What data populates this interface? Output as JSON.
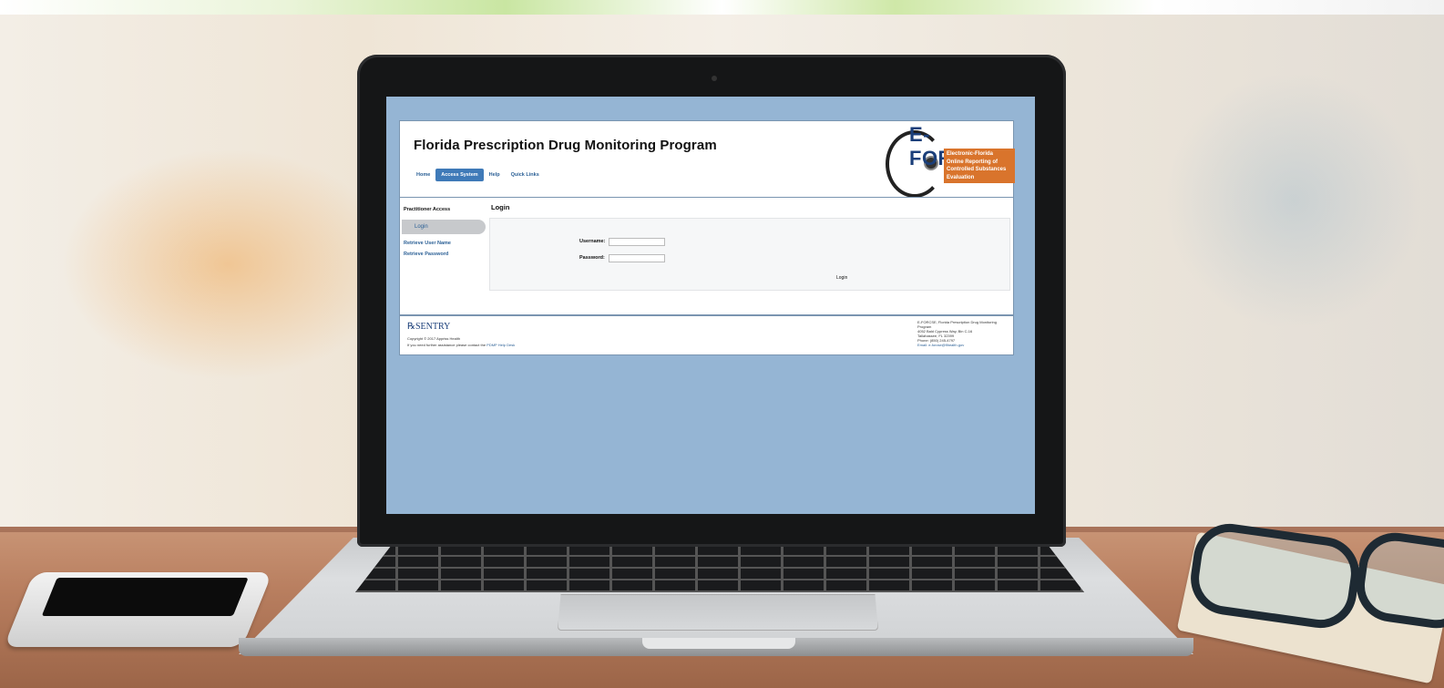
{
  "page": {
    "title": "Florida Prescription Drug Monitoring Program",
    "nav": [
      "Home",
      "Access System",
      "Help",
      "Quick Links"
    ],
    "active_nav_index": 1
  },
  "logo": {
    "title": "E-FORCSE",
    "lines": [
      "Electronic-Florida",
      "Online Reporting of",
      "Controlled Substances",
      "Evaluation"
    ],
    "rx_symbol": "℞"
  },
  "sidebar": {
    "title": "Practitioner Access",
    "items": [
      "Login",
      "Retrieve User Name",
      "Retrieve Password"
    ]
  },
  "login": {
    "title": "Login",
    "username_label": "Username:",
    "password_label": "Password:",
    "button": "Login"
  },
  "footer": {
    "brand": "℞SENTRY",
    "copyright": "Copyright © 2017 Appriss Health",
    "help_text": "If you need further assistance please contact the ",
    "help_link": "PDMP Help Desk",
    "address_lines": [
      "E-FORCSE, Florida Prescription Drug Monitoring",
      "Program",
      "4052 Bald Cypress Way, Bin C-16",
      "Tallahassee, FL 32399",
      "Phone: (850) 245-4797",
      "Email: e-forcse@flhealth.gov"
    ]
  },
  "colors": {
    "screen_bg": "#95b5d4",
    "nav_active": "#3f7ab8",
    "link": "#2a5f95",
    "logo_accent": "#d9742c"
  }
}
